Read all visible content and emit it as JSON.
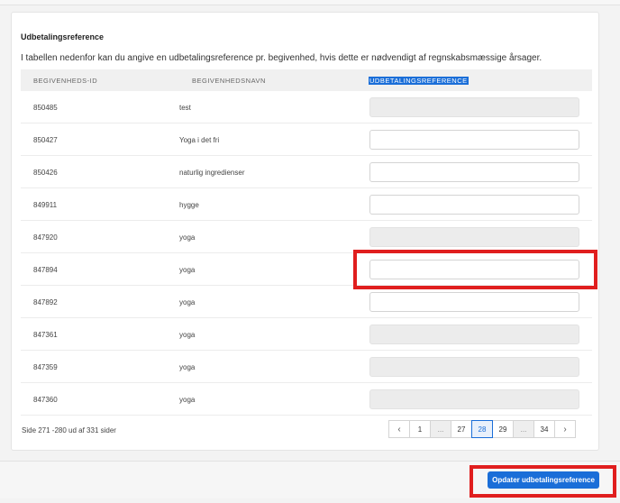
{
  "section": {
    "title": "Udbetalingsreference",
    "description": "I tabellen nedenfor kan du angive en udbetalingsreference pr. begivenhed, hvis dette er nødvendigt af regnskabsmæssige årsager."
  },
  "table": {
    "headers": {
      "event_id": "BEGIVENHEDS-ID",
      "event_name": "BEGIVENHEDSNAVN",
      "payout_reference": "UDBETALINGSREFERENCE"
    },
    "rows": [
      {
        "id": "850485",
        "name": "test",
        "reference": "",
        "editable": false
      },
      {
        "id": "850427",
        "name": "Yoga i det fri",
        "reference": "",
        "editable": true
      },
      {
        "id": "850426",
        "name": "naturlig ingredienser",
        "reference": "",
        "editable": true
      },
      {
        "id": "849911",
        "name": "hygge",
        "reference": "",
        "editable": true
      },
      {
        "id": "847920",
        "name": "yoga",
        "reference": "",
        "editable": false
      },
      {
        "id": "847894",
        "name": "yoga",
        "reference": "",
        "editable": true
      },
      {
        "id": "847892",
        "name": "yoga",
        "reference": "",
        "editable": true
      },
      {
        "id": "847361",
        "name": "yoga",
        "reference": "",
        "editable": false
      },
      {
        "id": "847359",
        "name": "yoga",
        "reference": "",
        "editable": false
      },
      {
        "id": "847360",
        "name": "yoga",
        "reference": "",
        "editable": false
      }
    ]
  },
  "pagination": {
    "info": "Side 271 -280 ud af 331 sider",
    "prev": "‹",
    "next": "›",
    "pages": [
      "1",
      "...",
      "27",
      "28",
      "29",
      "...",
      "34"
    ],
    "active": "28"
  },
  "footer": {
    "update_button": "Opdater udbetalingsreference"
  },
  "colors": {
    "accent": "#1a6ed8",
    "highlight": "#e01e1e"
  }
}
